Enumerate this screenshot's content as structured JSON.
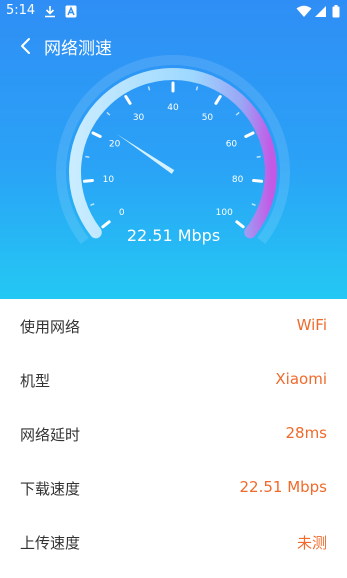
{
  "status_bar": {
    "time": "5:14",
    "icons": [
      "download-icon",
      "a-icon",
      "wifi-icon",
      "signal-icon",
      "battery-icon"
    ]
  },
  "header": {
    "title": "网络测速",
    "back_icon": "chevron-left-icon"
  },
  "gauge": {
    "tick_labels": [
      "0",
      "10",
      "20",
      "30",
      "40",
      "50",
      "60",
      "80",
      "100"
    ],
    "speed_display": "22.51 Mbps",
    "needle_reading": 22.51,
    "max": 100,
    "colors": {
      "arc_start": "#bfe6ff",
      "arc_mid": "#8fd0ff",
      "arc_end": "#c35ae6",
      "needle": "#d4f1ff"
    }
  },
  "info_rows": [
    {
      "label": "使用网络",
      "value": "WiFi"
    },
    {
      "label": "机型",
      "value": "Xiaomi"
    },
    {
      "label": "网络延时",
      "value": "28ms"
    },
    {
      "label": "下载速度",
      "value": "22.51 Mbps"
    },
    {
      "label": "上传速度",
      "value": "未测"
    }
  ],
  "colors": {
    "accent_value": "#f06a2c",
    "label": "#333333",
    "hero_top": "#2f8ef5",
    "hero_bottom": "#24c8f4"
  }
}
